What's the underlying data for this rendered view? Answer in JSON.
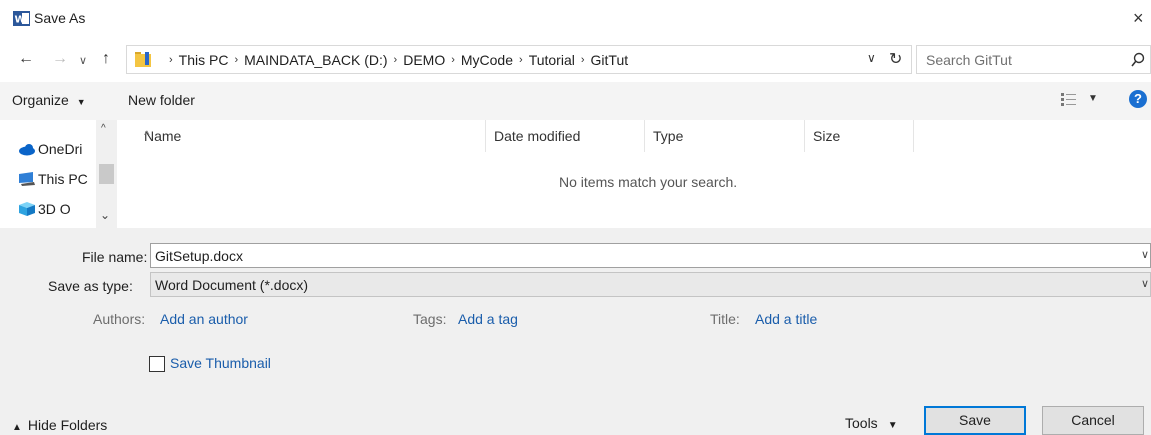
{
  "window": {
    "title": "Save As"
  },
  "address": {
    "crumbs": [
      "This PC",
      "MAINDATA_BACK (D:)",
      "DEMO",
      "MyCode",
      "Tutorial",
      "GitTut"
    ]
  },
  "search": {
    "placeholder": "Search GitTut"
  },
  "toolbar": {
    "organize_label": "Organize",
    "new_folder_label": "New folder"
  },
  "navpane": {
    "items": [
      {
        "label": "OneDri",
        "icon": "onedrive-cloud-icon"
      },
      {
        "label": "This PC",
        "icon": "this-pc-icon"
      },
      {
        "label": "3D O",
        "icon": "3d-objects-icon"
      }
    ]
  },
  "filelist": {
    "columns": [
      "Name",
      "Date modified",
      "Type",
      "Size"
    ],
    "empty_message": "No items match your search."
  },
  "form": {
    "file_name_label": "File name:",
    "file_name_value": "GitSetup.docx",
    "save_type_label": "Save as type:",
    "save_type_value": "Word Document (*.docx)",
    "authors_label": "Authors:",
    "authors_link": "Add an author",
    "tags_label": "Tags:",
    "tags_link": "Add a tag",
    "title_label": "Title:",
    "title_link": "Add a title",
    "thumbnail_label": "Save Thumbnail",
    "thumbnail_checked": false
  },
  "footer": {
    "hide_folders_label": "Hide Folders",
    "tools_label": "Tools",
    "save_label": "Save",
    "cancel_label": "Cancel"
  },
  "colors": {
    "accent": "#0078d7",
    "link": "#1a5dab",
    "panel_bg": "#f0f0f0"
  }
}
